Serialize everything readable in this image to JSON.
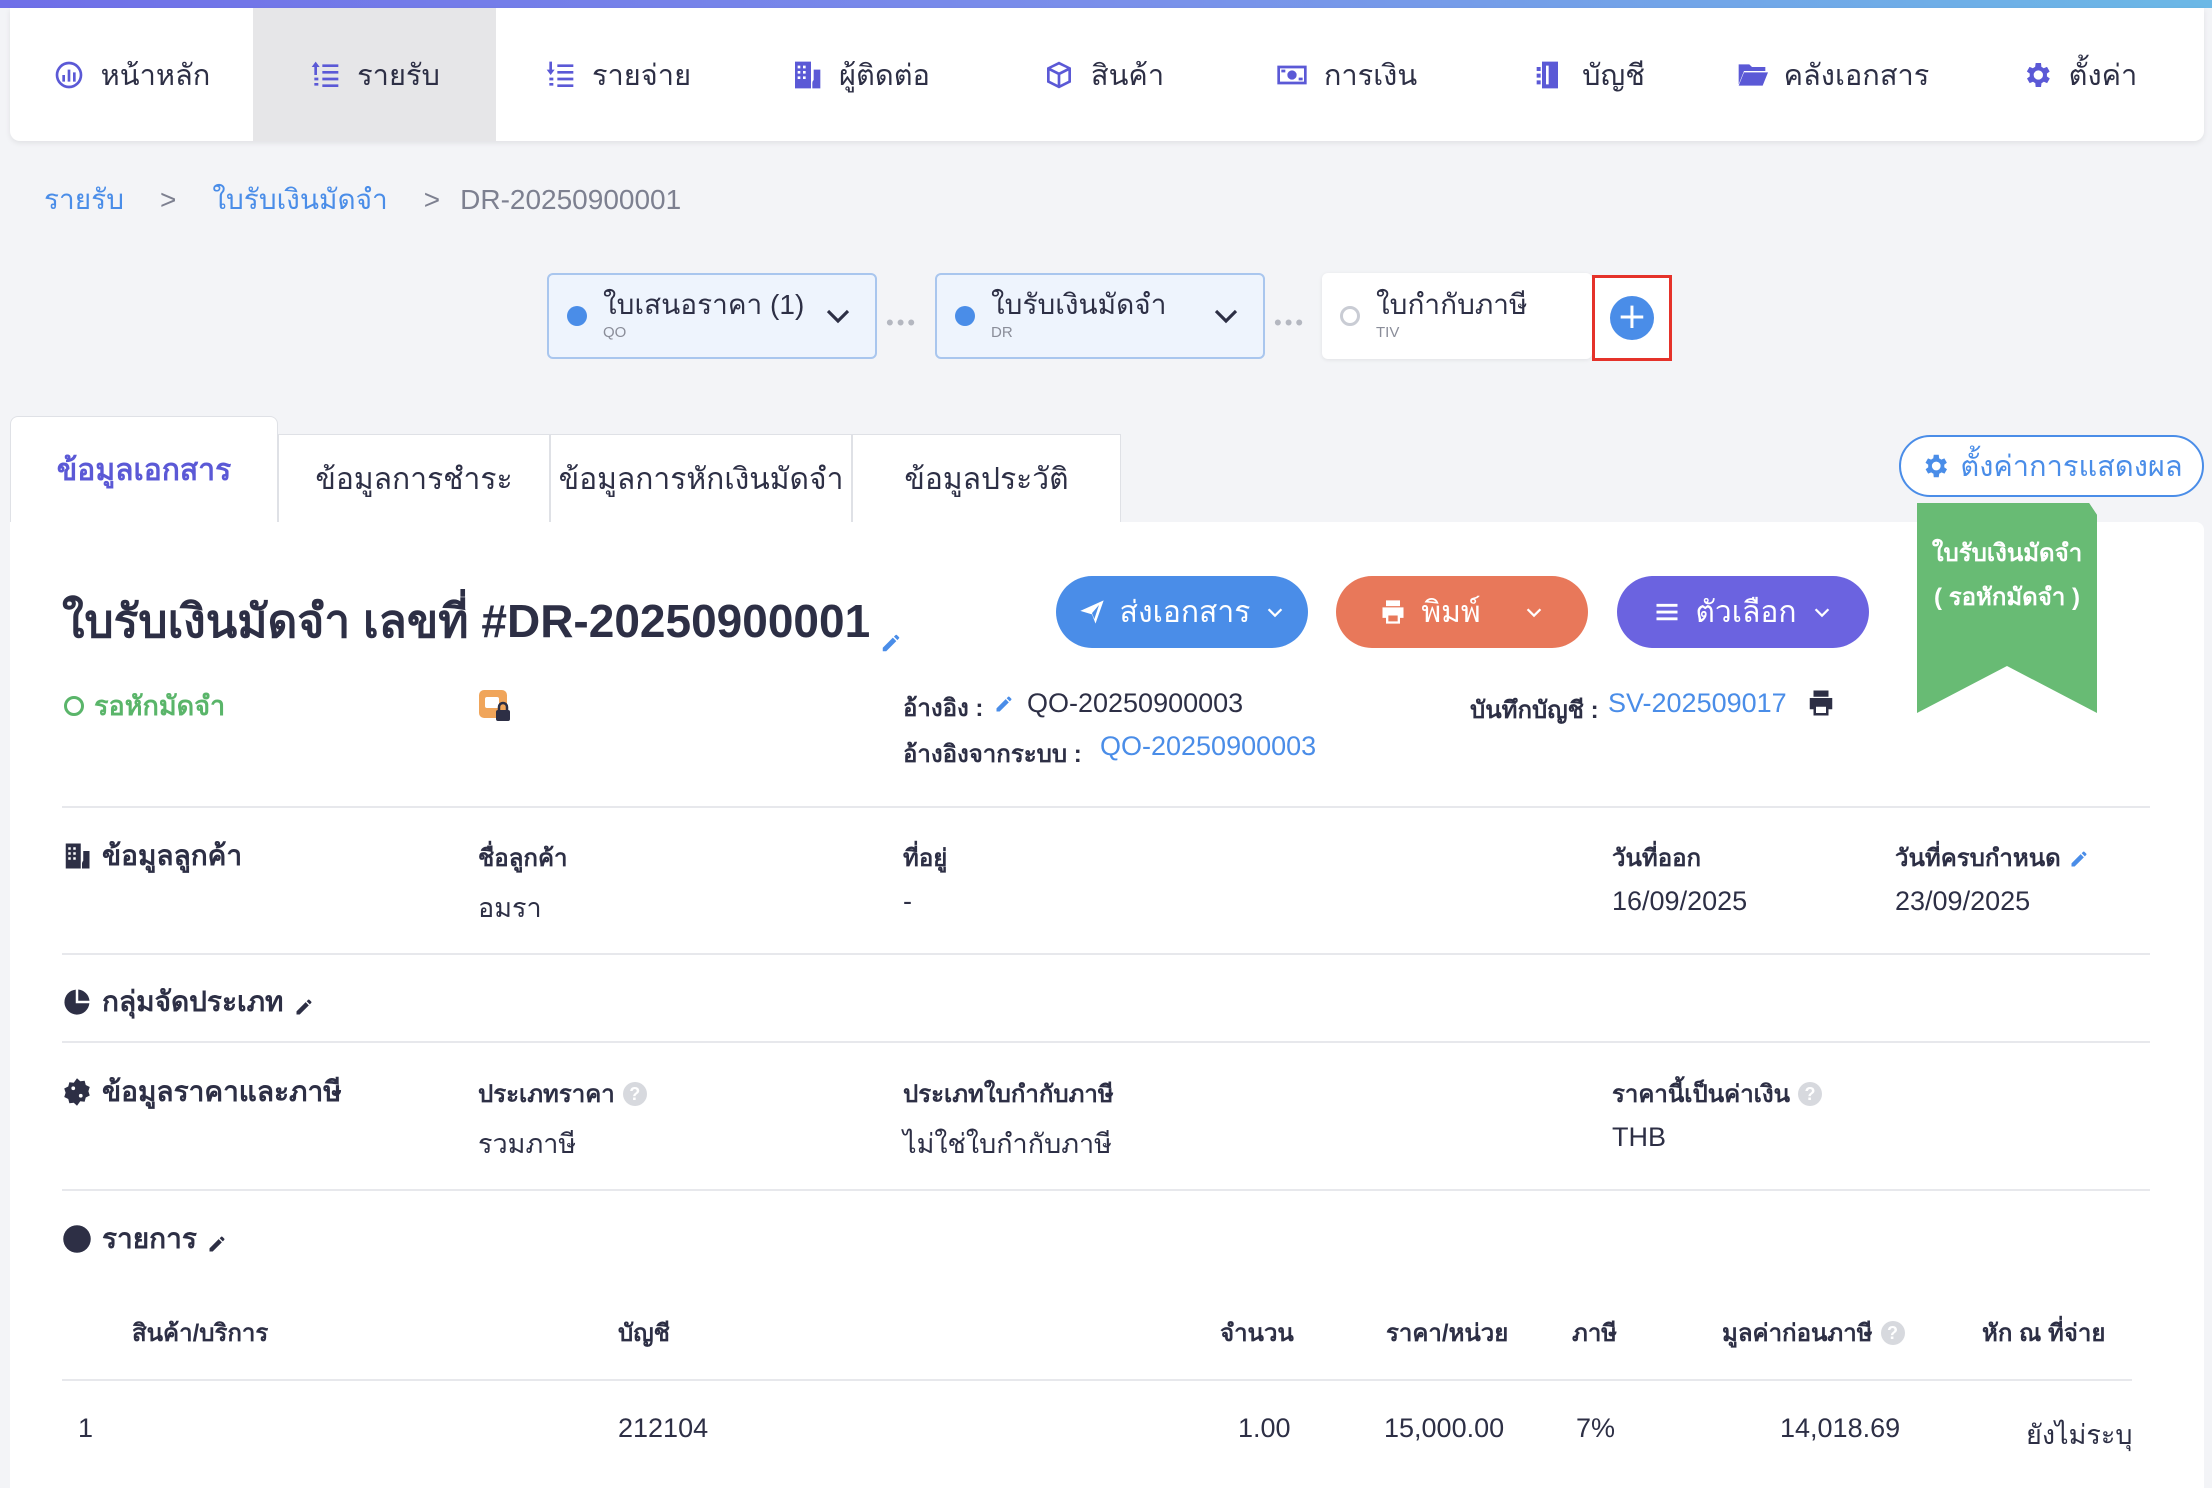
{
  "nav": [
    {
      "label": "หน้าหลัก",
      "icon": "dashboard-icon"
    },
    {
      "label": "รายรับ",
      "icon": "income-icon"
    },
    {
      "label": "รายจ่าย",
      "icon": "expense-icon"
    },
    {
      "label": "ผู้ติดต่อ",
      "icon": "contacts-icon"
    },
    {
      "label": "สินค้า",
      "icon": "product-icon"
    },
    {
      "label": "การเงิน",
      "icon": "money-icon"
    },
    {
      "label": "บัญชี",
      "icon": "accounting-icon"
    },
    {
      "label": "คลังเอกสาร",
      "icon": "folder-icon"
    },
    {
      "label": "ตั้งค่า",
      "icon": "gear-icon"
    }
  ],
  "nav_active": "รายรับ",
  "breadcrumb": {
    "l1": "รายรับ",
    "sep": ">",
    "l2": "ใบรับเงินมัดจำ",
    "current": "DR-20250900001"
  },
  "workflow": [
    {
      "name": "ใบเสนอราคา (1)",
      "code": "QO",
      "state": "done"
    },
    {
      "name": "ใบรับเงินมัดจำ",
      "code": "DR",
      "state": "done"
    },
    {
      "name": "ใบกำกับภาษี",
      "code": "TIV",
      "state": "pending"
    }
  ],
  "workflow_add": "+",
  "tabs": [
    "ข้อมูลเอกสาร",
    "ข้อมูลการชำระ",
    "ข้อมูลการหักเงินมัดจำ",
    "ข้อมูลประวัติ"
  ],
  "display_settings": "ตั้งค่าการแสดงผล",
  "doc": {
    "title": "ใบรับเงินมัดจำ เลขที่ #DR-20250900001",
    "status": "รอหักมัดจำ",
    "ribbon_line1": "ใบรับเงินมัดจำ",
    "ribbon_line2": "( รอหักมัดจำ )",
    "ref_label": "อ้างอิง :",
    "ref_value": "QO-20250900003",
    "sys_ref_label": "อ้างอิงจากระบบ :",
    "sys_ref_value": "QO-20250900003",
    "ledger_label": "บันทึกบัญชี :",
    "ledger_value": "SV-202509017"
  },
  "actions": {
    "send": "ส่งเอกสาร",
    "print": "พิมพ์",
    "options": "ตัวเลือก"
  },
  "customer": {
    "section": "ข้อมูลลูกค้า",
    "name_label": "ชื่อลูกค้า",
    "name": "อมรา",
    "address_label": "ที่อยู่",
    "address": "-",
    "issue_label": "วันที่ออก",
    "issue": "16/09/2025",
    "due_label": "วันที่ครบกำหนด",
    "due": "23/09/2025"
  },
  "category": {
    "section": "กลุ่มจัดประเภท"
  },
  "pricing": {
    "section": "ข้อมูลราคาและภาษี",
    "price_type_label": "ประเภทราคา",
    "price_type": "รวมภาษี",
    "tax_inv_label": "ประเภทใบกำกับภาษี",
    "tax_inv": "ไม่ใช่ใบกำกับภาษี",
    "currency_label": "ราคานี้เป็นค่าเงิน",
    "currency": "THB"
  },
  "items": {
    "section": "รายการ",
    "headers": {
      "product": "สินค้า/บริการ",
      "account": "บัญชี",
      "qty": "จำนวน",
      "unit_price": "ราคา/หน่วย",
      "tax": "ภาษี",
      "pretax": "มูลค่าก่อนภาษี",
      "wht": "หัก ณ ที่จ่าย"
    },
    "rows": [
      {
        "no": "1",
        "account": "212104",
        "qty": "1.00",
        "unit_price": "15,000.00",
        "tax": "7%",
        "pretax": "14,018.69",
        "wht": "ยังไม่ระบุ"
      }
    ]
  },
  "colors": {
    "accent": "#4a8de8",
    "status_green": "#5ab56a",
    "print": "#e8785a",
    "options": "#6b63e0"
  }
}
